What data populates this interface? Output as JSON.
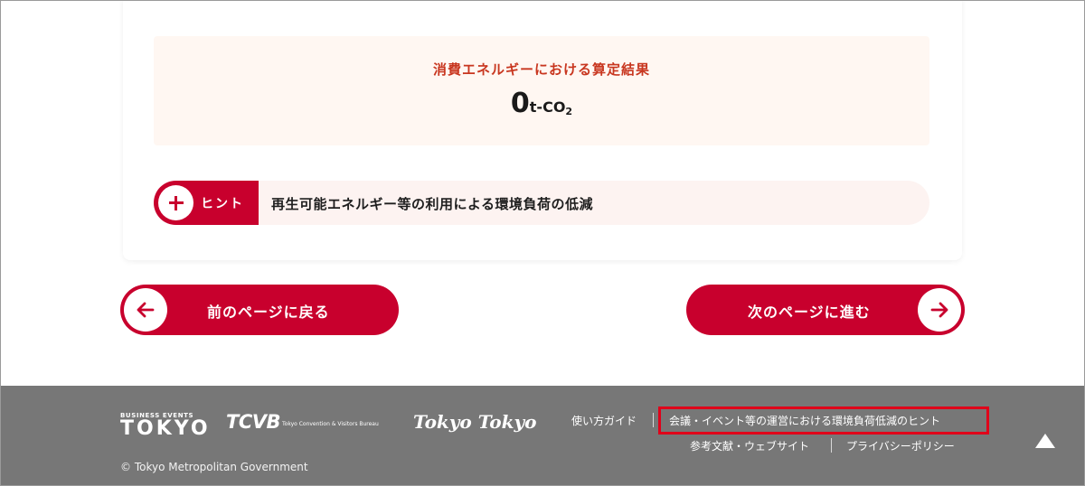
{
  "result": {
    "title": "消費エネルギーにおける算定結果",
    "value": "0",
    "unit": "t-CO",
    "unit_sub": "2"
  },
  "hint": {
    "tag_label": "ヒント",
    "text": "再生可能エネルギー等の利用による環境負荷の低減",
    "icon": "plus-icon"
  },
  "navigation": {
    "prev_label": "前のページに戻る",
    "next_label": "次のページに進む",
    "prev_icon": "arrow-left-icon",
    "next_icon": "arrow-right-icon"
  },
  "footer": {
    "logos": {
      "business_events_small": "BUSINESS EVENTS",
      "business_events_big": "TOKYO",
      "tcvb_big": "TCVB",
      "tcvb_small": "Tokyo Convention & Visitors Bureau",
      "tokyo_tokyo": "Tokyo Tokyo"
    },
    "links": {
      "guide": "使い方ガイド",
      "hints": "会議・イベント等の運営における環境負荷低減のヒント",
      "references": "参考文献・ウェブサイト",
      "privacy": "プライバシーポリシー"
    },
    "copyright": "© Tokyo Metropolitan Government",
    "to_top_icon": "triangle-up-icon"
  },
  "colors": {
    "brand_red": "#c8002d",
    "title_orange": "#c8361f",
    "footer_gray": "#777777",
    "highlight_red": "#e0001a",
    "result_bg": "#fff7f2",
    "hint_bg": "#fdf3f1"
  }
}
